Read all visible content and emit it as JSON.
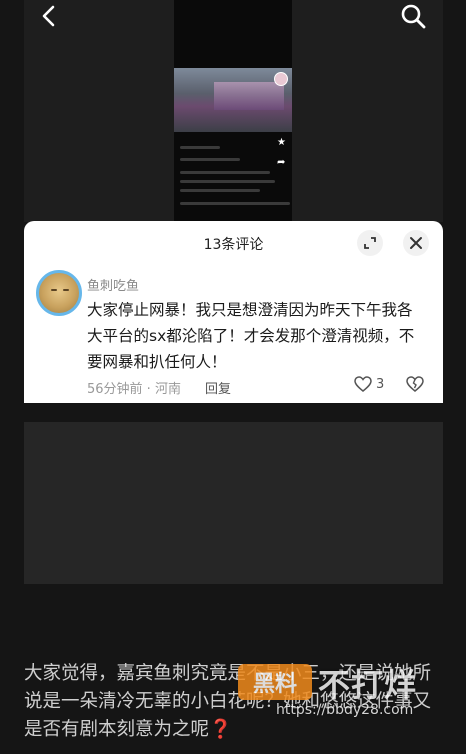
{
  "header": {
    "back_icon": "chevron-left-icon",
    "search_icon": "search-icon"
  },
  "card": {
    "title": "13条评论",
    "expand_icon": "expand-icon",
    "close_icon": "close-icon"
  },
  "comment": {
    "username": "鱼刺吃鱼",
    "text": "大家停止网暴！我只是想澄清因为昨天下午我各大平台的sx都沦陷了！才会发那个澄清视频，不要网暴和扒任何人！",
    "time": "56分钟前 · 河南",
    "reply_label": "回复",
    "likes": "3",
    "like_icon": "heart-outline-icon",
    "dislike_icon": "broken-heart-icon"
  },
  "article": {
    "text": "大家觉得，嘉宾鱼刺究竟是不是小三，还是说她所说是一朵清冷无辜的小白花呢？她和悠悠这件事又是否有剧本刻意为之呢",
    "qmark": "❓"
  },
  "watermark": {
    "badge": "黑料",
    "title": "不打烊",
    "url": "https://bbdy28.com"
  },
  "colors": {
    "background": "#151515",
    "card": "#ffffff",
    "watermark_orange": "#f08a1c",
    "avatar_ring": "#66b7ea"
  }
}
